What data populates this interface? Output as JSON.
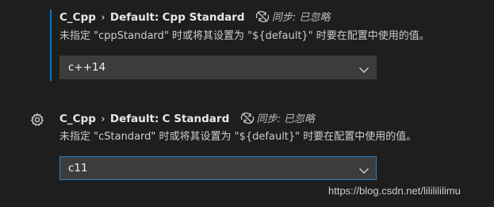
{
  "settings": [
    {
      "category": "C_Cpp",
      "separator": "›",
      "scope": "Default:",
      "name": "Cpp Standard",
      "sync_status": "同步: 已忽略",
      "sync_icon": "sync-ignored-icon",
      "description": "未指定 \"cppStandard\" 时或将其设置为 \"${default}\" 时要在配置中使用的值。",
      "value": "c++14"
    },
    {
      "category": "C_Cpp",
      "separator": "›",
      "scope": "Default:",
      "name": "C Standard",
      "sync_status": "同步: 已忽略",
      "sync_icon": "sync-ignored-icon",
      "description": "未指定 \"cStandard\" 时或将其设置为 \"${default}\" 时要在配置中使用的值。",
      "value": "c11"
    }
  ],
  "watermark": "https://blog.csdn.net/lililililimu",
  "colors": {
    "background": "#1e1e1e",
    "accent": "#007acc",
    "focus_border": "#2f80c7",
    "select_bg": "#3c3c3c"
  }
}
